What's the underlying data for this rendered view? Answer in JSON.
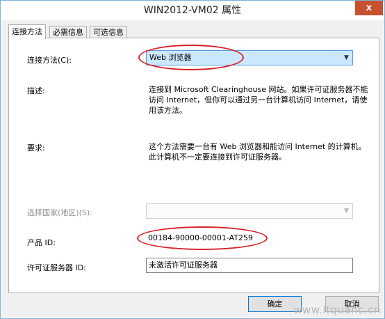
{
  "window": {
    "title": "WIN2012-VM02 属性",
    "close_glyph": "x"
  },
  "tabs": [
    {
      "label": "连接方法",
      "active": true
    },
    {
      "label": "必需信息",
      "active": false
    },
    {
      "label": "可选信息",
      "active": false
    }
  ],
  "form": {
    "method": {
      "label": "连接方法(C):",
      "value": "Web 浏览器"
    },
    "description": {
      "label": "描述:",
      "text": "连接到 Microsoft Clearinghouse 网站。如果许可证服务器不能访问 Internet，但你可以通过另一台计算机访问 Internet，请使用该方法。"
    },
    "requirements": {
      "label": "要求:",
      "text": "这个方法需要一台有 Web 浏览器和能访问 Internet 的计算机。此计算机不一定要连接到许可证服务器。"
    },
    "country": {
      "label": "选择国家(地区)(S):",
      "value": ""
    },
    "product_id": {
      "label": "产品 ID:",
      "value": "00184-90000-00001-AT259"
    },
    "license_server_id": {
      "label": "许可证服务器 ID:",
      "value": "未激活许可证服务器"
    }
  },
  "buttons": {
    "ok": "确定",
    "cancel": "取消"
  },
  "watermark": "www.ltquanc.cn",
  "colors": {
    "highlight_ellipse": "#d8232a",
    "selected_combo": "#cce8ff",
    "title_close": "#c7502f"
  }
}
